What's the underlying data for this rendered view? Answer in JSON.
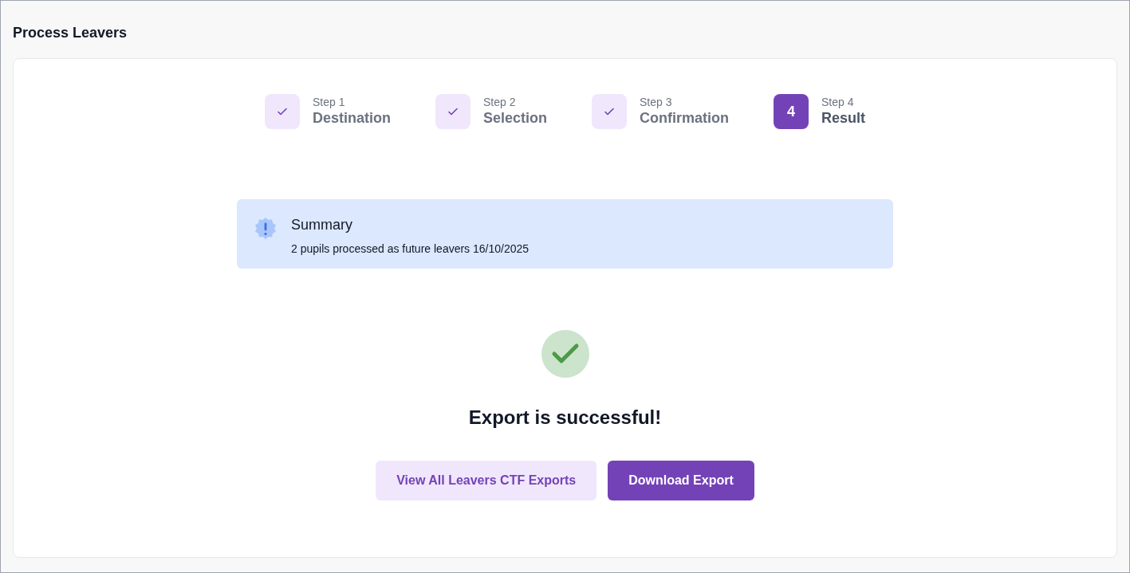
{
  "window": {
    "title": "Process Leavers"
  },
  "steps": [
    {
      "label": "Step 1",
      "name": "Destination",
      "completed": true,
      "selected": false
    },
    {
      "label": "Step 2",
      "name": "Selection",
      "completed": true,
      "selected": false
    },
    {
      "label": "Step 3",
      "name": "Confirmation",
      "completed": true,
      "selected": false
    },
    {
      "label": "Step 4",
      "name": "Result",
      "number": "4",
      "completed": false,
      "selected": true
    }
  ],
  "summary": {
    "title": "Summary",
    "text": "2 pupils processed as future leavers 16/10/2025"
  },
  "result": {
    "message": "Export is successful!"
  },
  "buttons": [
    {
      "label": "View All Leavers CTF Exports",
      "kind": "secondary"
    },
    {
      "label": "Download Export",
      "kind": "primary"
    }
  ]
}
